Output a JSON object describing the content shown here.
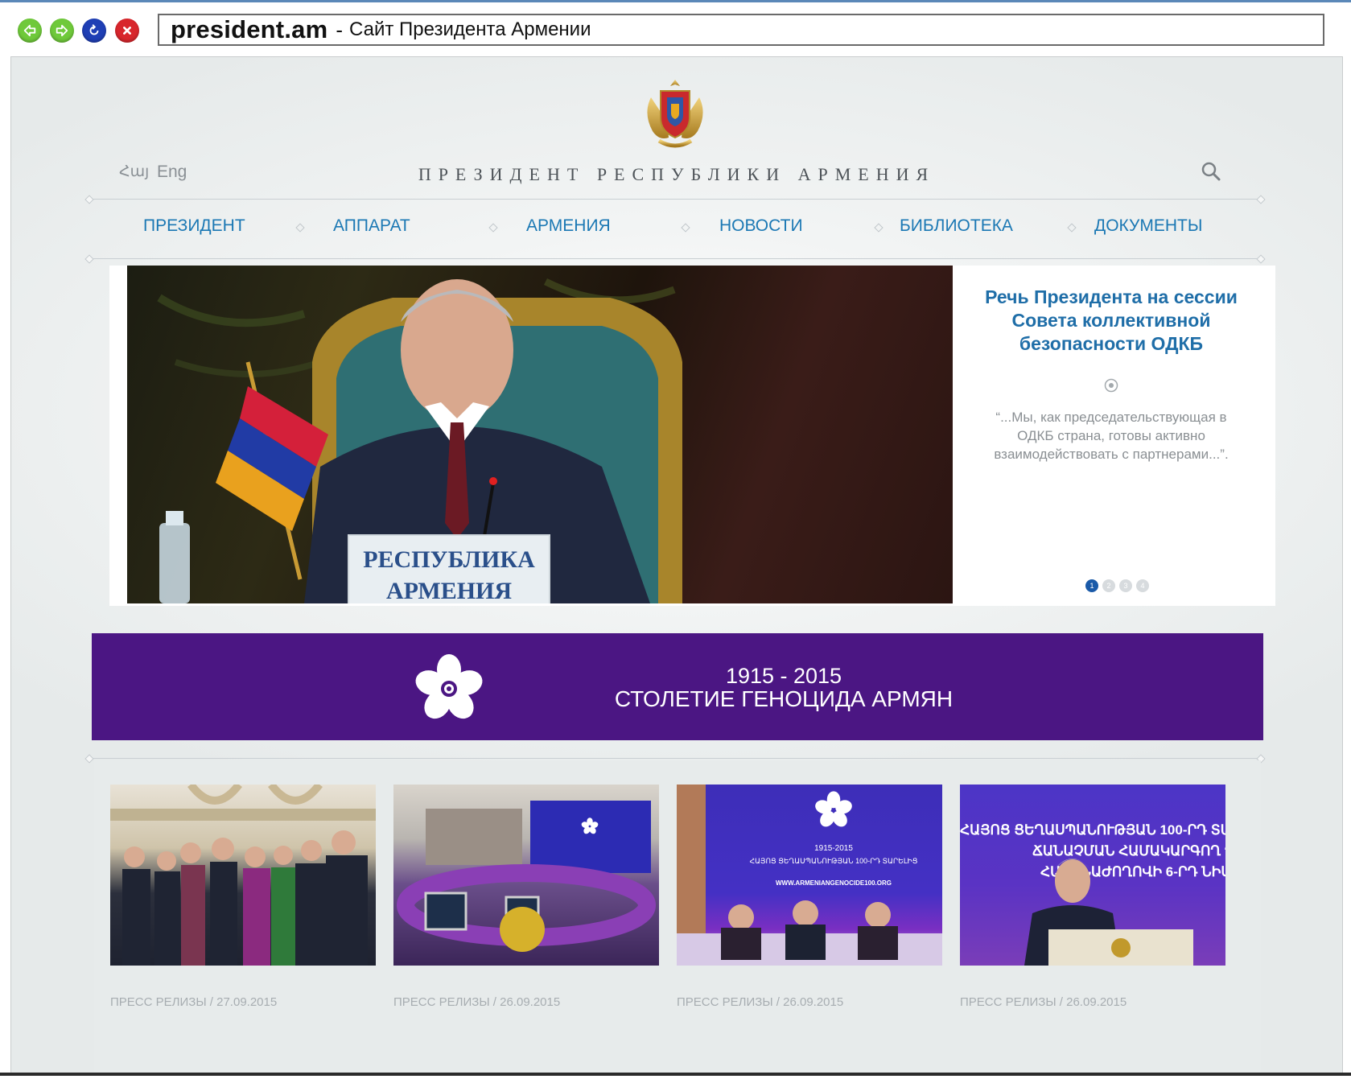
{
  "browser": {
    "domain": "president.am",
    "separator": "-",
    "page_title": "Сайт Президента Армении"
  },
  "header": {
    "lang_hy": "Հայ",
    "lang_en": "Eng",
    "site_title": "ПРЕЗИДЕНТ РЕСПУБЛИКИ АРМЕНИЯ"
  },
  "menu": [
    "ПРЕЗИДЕНТ",
    "АППАРАТ",
    "АРМЕНИЯ",
    "НОВОСТИ",
    "БИБЛИОТЕКА",
    "ДОКУМЕНТЫ"
  ],
  "slider": {
    "title": "Речь Президента на сессии Совета коллективной безопасности ОДКБ",
    "quote": "“...Мы, как председательствующая в ОДКБ страна, готовы активно взаимодействовать с партнерами...”.",
    "nameplate_line1": "РЕСПУБЛИКА",
    "nameplate_line2": "АРМЕНИЯ",
    "dots": [
      "1",
      "2",
      "3",
      "4"
    ],
    "active_dot": 1
  },
  "banner": {
    "years": "1915 - 2015",
    "title": "СТОЛЕТИЕ ГЕНОЦИДА АРМЯН",
    "color": "#4b1683"
  },
  "news": [
    {
      "category": "ПРЕСС РЕЛИЗЫ",
      "date": "27.09.2015"
    },
    {
      "category": "ПРЕСС РЕЛИЗЫ",
      "date": "26.09.2015"
    },
    {
      "category": "ПРЕСС РЕЛИЗЫ",
      "date": "26.09.2015"
    },
    {
      "category": "ПРЕСС РЕЛИЗЫ",
      "date": "26.09.2015"
    }
  ],
  "news_photo_texts": {
    "card3_line1": "1915-2015",
    "card3_line2": "ՀԱՅՈՑ ՑԵՂԱՍՊԱՆՈՒԹՅԱՆ 100-ՐԴ ՏԱՐԵԼԻՑ",
    "card3_url": "WWW.ARMENIANGENOCIDE100.ORG",
    "card4_line1": "ՀԱՅՈՑ ՑԵՂԱՍՊԱՆՈՒԹՅԱՆ 100-ՐԴ ՏԱ",
    "card4_line2": "ՃԱՆԱՉՄԱՆ ՀԱՄԱԿԱՐԳՈՂ ՊԵ",
    "card4_line3": "ՀԱՆՁՆԱԺՈՂՈՎԻ 6-ՐԴ ՆԻՍՏ"
  },
  "colors": {
    "link_blue": "#1b78b4",
    "slide_title": "#1f6ea8",
    "muted": "#8a9095",
    "banner_purple": "#4b1683"
  },
  "icons": {
    "back": "arrow-left-icon",
    "forward": "arrow-right-icon",
    "reload": "reload-icon",
    "stop": "stop-icon",
    "search": "search-icon",
    "emblem": "coat-of-arms-icon",
    "flower": "forget-me-not-icon"
  }
}
